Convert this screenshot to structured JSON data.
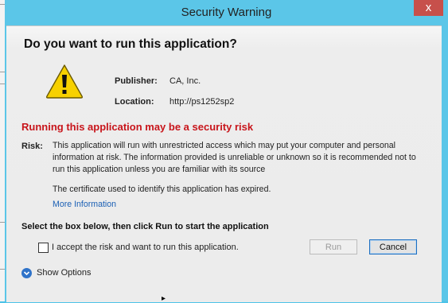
{
  "window": {
    "title": "Security Warning",
    "close_glyph": "x"
  },
  "dialog": {
    "heading": "Do you want to run this application?",
    "warning_icon": "warning-triangle-icon",
    "publisher": {
      "label": "Publisher:",
      "value": "CA, Inc."
    },
    "location": {
      "label": "Location:",
      "value": "http://ps1252sp2"
    },
    "risk_title": "Running this application may be a security risk",
    "risk_label": "Risk:",
    "risk_text": "This application will run with unrestricted access which may put your computer and personal information at risk. The information provided is unreliable or unknown so it is recommended not to run this application unless you are familiar with its source",
    "certificate_text": "The certificate used to identify this application has expired.",
    "more_information": "More Information",
    "select_instruction": "Select the box below, then click Run to start the application",
    "accept_checkbox_label": "I accept the risk and want to run this application.",
    "run_button": "Run",
    "cancel_button": "Cancel",
    "show_options": "Show Options"
  },
  "colors": {
    "title_bar": "#5bc6e8",
    "risk_red": "#c8151b",
    "link_blue": "#1a5fb4",
    "close_red": "#c7504b"
  }
}
